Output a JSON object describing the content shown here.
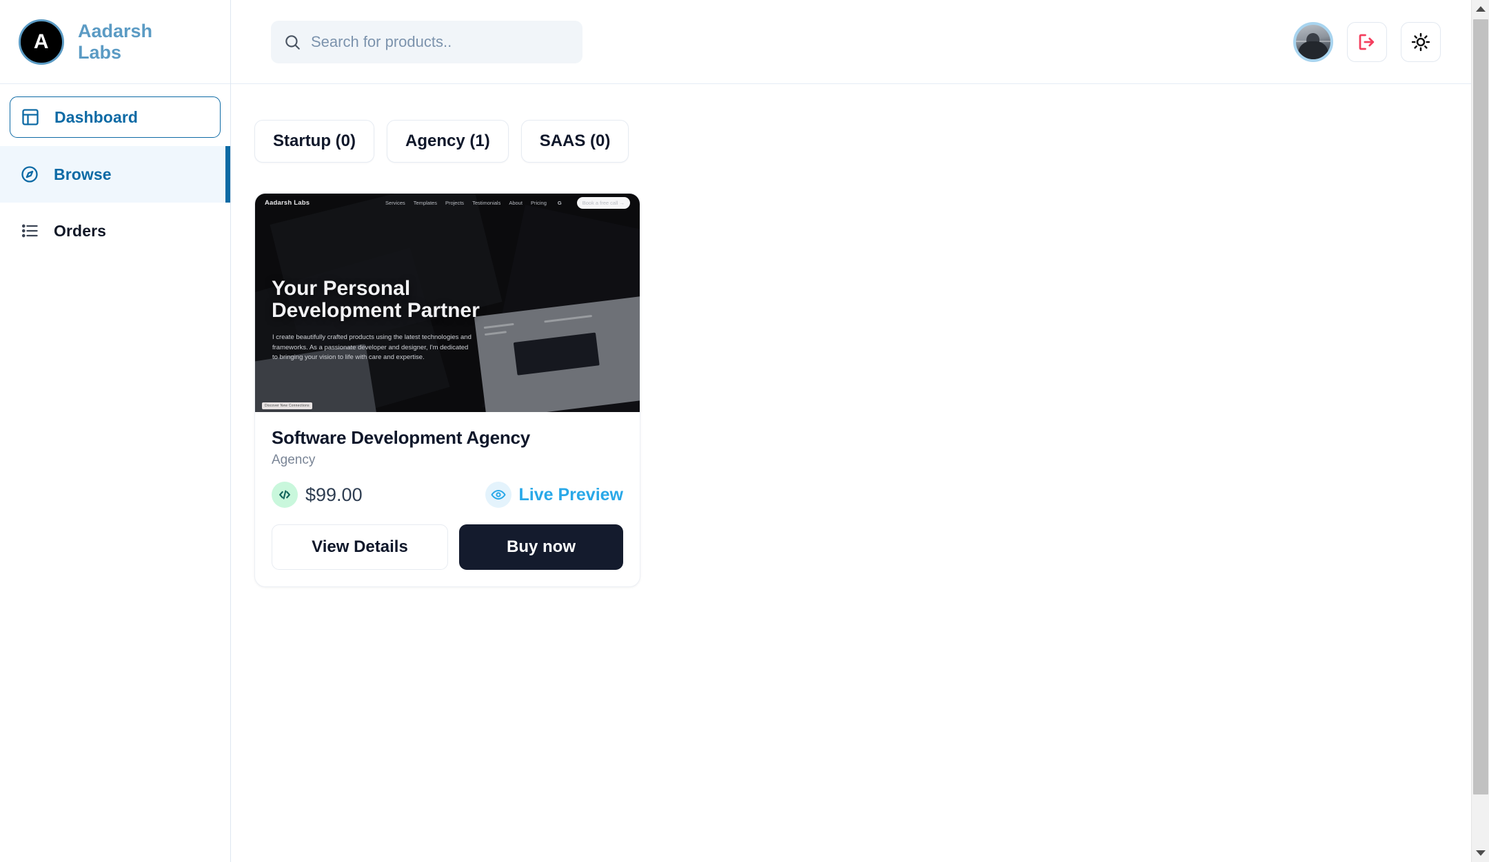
{
  "brand": {
    "logo_letter": "A",
    "name": "Aadarsh Labs",
    "logo_icon": "circle-avatar-logo"
  },
  "sidebar": {
    "items": [
      {
        "label": "Dashboard",
        "icon": "layout-dashboard-icon",
        "state": "boxed"
      },
      {
        "label": "Browse",
        "icon": "compass-icon",
        "state": "active"
      },
      {
        "label": "Orders",
        "icon": "list-icon",
        "state": "plain"
      }
    ]
  },
  "topbar": {
    "search": {
      "placeholder": "Search for products..",
      "value": "",
      "icon": "search-icon"
    },
    "avatar_alt": "user-avatar",
    "logout_icon": "logout-icon",
    "theme_icon": "sun-icon"
  },
  "filters": [
    {
      "label": "Startup (0)",
      "name": "startup",
      "count": 0
    },
    {
      "label": "Agency (1)",
      "name": "agency",
      "count": 1
    },
    {
      "label": "SAAS (0)",
      "name": "saas",
      "count": 0
    }
  ],
  "product": {
    "title": "Software Development Agency",
    "category": "Agency",
    "price": "$99.00",
    "code_icon": "code-icon",
    "preview": {
      "label": "Live Preview",
      "icon": "eye-icon"
    },
    "buttons": {
      "details": "View Details",
      "buy": "Buy now"
    },
    "thumbnail": {
      "site_logo": "Aadarsh Labs",
      "nav_links": [
        "Services",
        "Templates",
        "Projects",
        "Testimonials",
        "About",
        "Pricing"
      ],
      "nav_icon": "g-icon",
      "cta": "Book a free call →",
      "hero_title_line1": "Your Personal",
      "hero_title_line2": "Development Partner",
      "hero_desc": "I create beautifully crafted products using the latest technologies and frameworks. As a passionate developer and designer, I'm dedicated to bringing your vision to life with care and expertise.",
      "corner_badge": "Discover New Connections"
    }
  },
  "colors": {
    "brand_blue": "#5b9bc4",
    "nav_active_blue": "#0d6aa5",
    "nav_active_bg": "#f0f7fd",
    "preview_blue": "#29a8e8",
    "code_badge_green": "#c9f7dc",
    "buy_dark": "#141b2d",
    "logout_red": "#f43f5e"
  }
}
